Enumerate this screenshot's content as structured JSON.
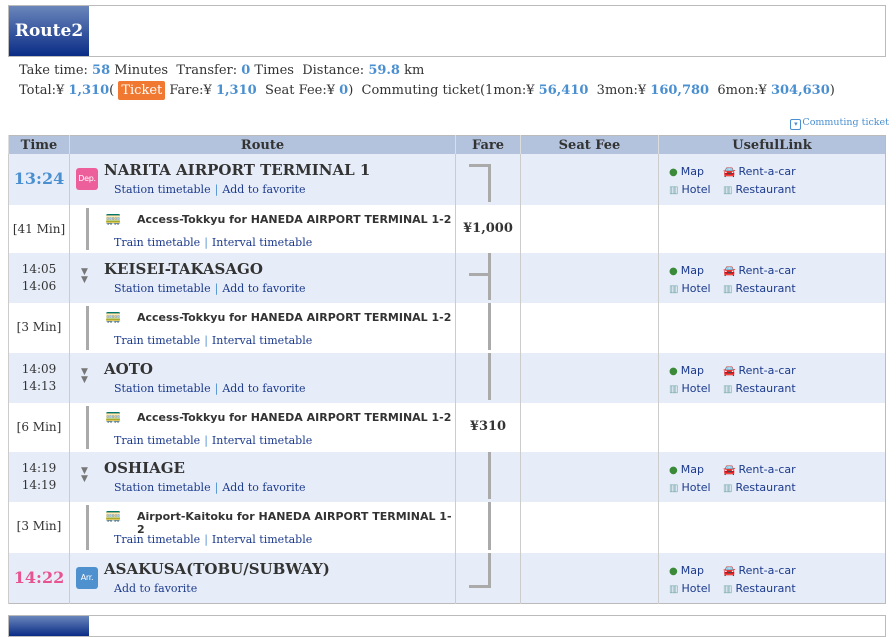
{
  "route_title": "Route2",
  "summary": {
    "take_time_label": "Take time: ",
    "take_time": "58",
    "minutes_label": " Minutes  Transfer: ",
    "transfer": "0",
    "times_label": " Times  Distance: ",
    "distance": "59.8",
    "km_label": " km",
    "total_label": "Total:¥ ",
    "total": "1,310",
    "paren_open": "( ",
    "ticket_badge": "Ticket",
    "fare_label": " Fare:¥ ",
    "fare": "1,310",
    "seat_label": "  Seat Fee:¥ ",
    "seat": "0",
    "commute_label": ")  Commuting ticket(1mon:¥ ",
    "mon1": "56,410",
    "mon3_label": "  3mon:¥ ",
    "mon3": "160,780",
    "mon6_label": "  6mon:¥ ",
    "mon6": "304,630",
    "paren_close": ")"
  },
  "commuting_ticket_link": "Commuting ticket",
  "headers": [
    "Time",
    "Route",
    "Fare",
    "Seat Fee",
    "UsefulLink"
  ],
  "useful_links": {
    "map": "Map",
    "rentacar": "Rent-a-car",
    "hotel": "Hotel",
    "restaurant": "Restaurant"
  },
  "link_labels": {
    "station_timetable": "Station timetable",
    "add_favorite": "Add to favorite",
    "train_timetable": "Train timetable",
    "interval_timetable": "Interval timetable",
    "sep": "|"
  },
  "icons": {
    "dep": "Dep.",
    "arr": "Arr."
  },
  "colors": {
    "departure": "#4a8fd0",
    "arrival": "#e8528f",
    "ticket": "#f07830"
  },
  "rows": [
    {
      "type": "station",
      "kind": "dep",
      "time": "13:24",
      "name": "NARITA AIRPORT TERMINAL 1",
      "fareline": "start"
    },
    {
      "type": "segment",
      "duration": "[41 Min]",
      "train": "Access-Tokkyu  for HANEDA AIRPORT TERMINAL 1-2",
      "fare": "¥1,000"
    },
    {
      "type": "station",
      "kind": "via",
      "time_arr": "14:05",
      "time_dep": "14:06",
      "name": "KEISEI-TAKASAGO",
      "fareline": "split"
    },
    {
      "type": "segment",
      "duration": "[3 Min]",
      "train": "Access-Tokkyu  for HANEDA AIRPORT TERMINAL 1-2",
      "fare": "",
      "fareline": "line"
    },
    {
      "type": "station",
      "kind": "via",
      "time_arr": "14:09",
      "time_dep": "14:13",
      "name": "AOTO",
      "fareline": "line"
    },
    {
      "type": "segment",
      "duration": "[6 Min]",
      "train": "Access-Tokkyu  for HANEDA AIRPORT TERMINAL 1-2",
      "fare": "¥310"
    },
    {
      "type": "station",
      "kind": "via",
      "time_arr": "14:19",
      "time_dep": "14:19",
      "name": "OSHIAGE",
      "fareline": "line"
    },
    {
      "type": "segment",
      "duration": "[3 Min]",
      "train": "Airport-Kaitoku  for HANEDA AIRPORT TERMINAL 1-2",
      "fare": "",
      "fareline": "line"
    },
    {
      "type": "station",
      "kind": "arr",
      "time": "14:22",
      "name": "ASAKUSA(TOBU/SUBWAY)",
      "fareline": "end"
    }
  ]
}
